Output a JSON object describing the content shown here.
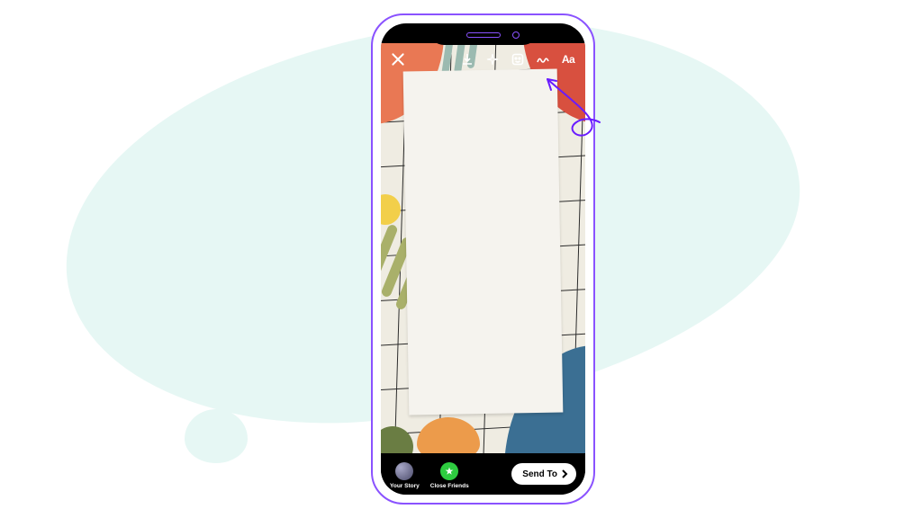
{
  "toolbar": {
    "close_name": "close",
    "download_name": "download",
    "effects_name": "effects",
    "sticker_name": "sticker",
    "draw_name": "draw",
    "text_name": "text",
    "text_label": "Aa"
  },
  "bottom": {
    "your_story_label": "Your Story",
    "close_friends_label": "Close Friends",
    "send_to_label": "Send To"
  },
  "colors": {
    "accent": "#8a52ff",
    "blob": "#e6f7f4"
  }
}
